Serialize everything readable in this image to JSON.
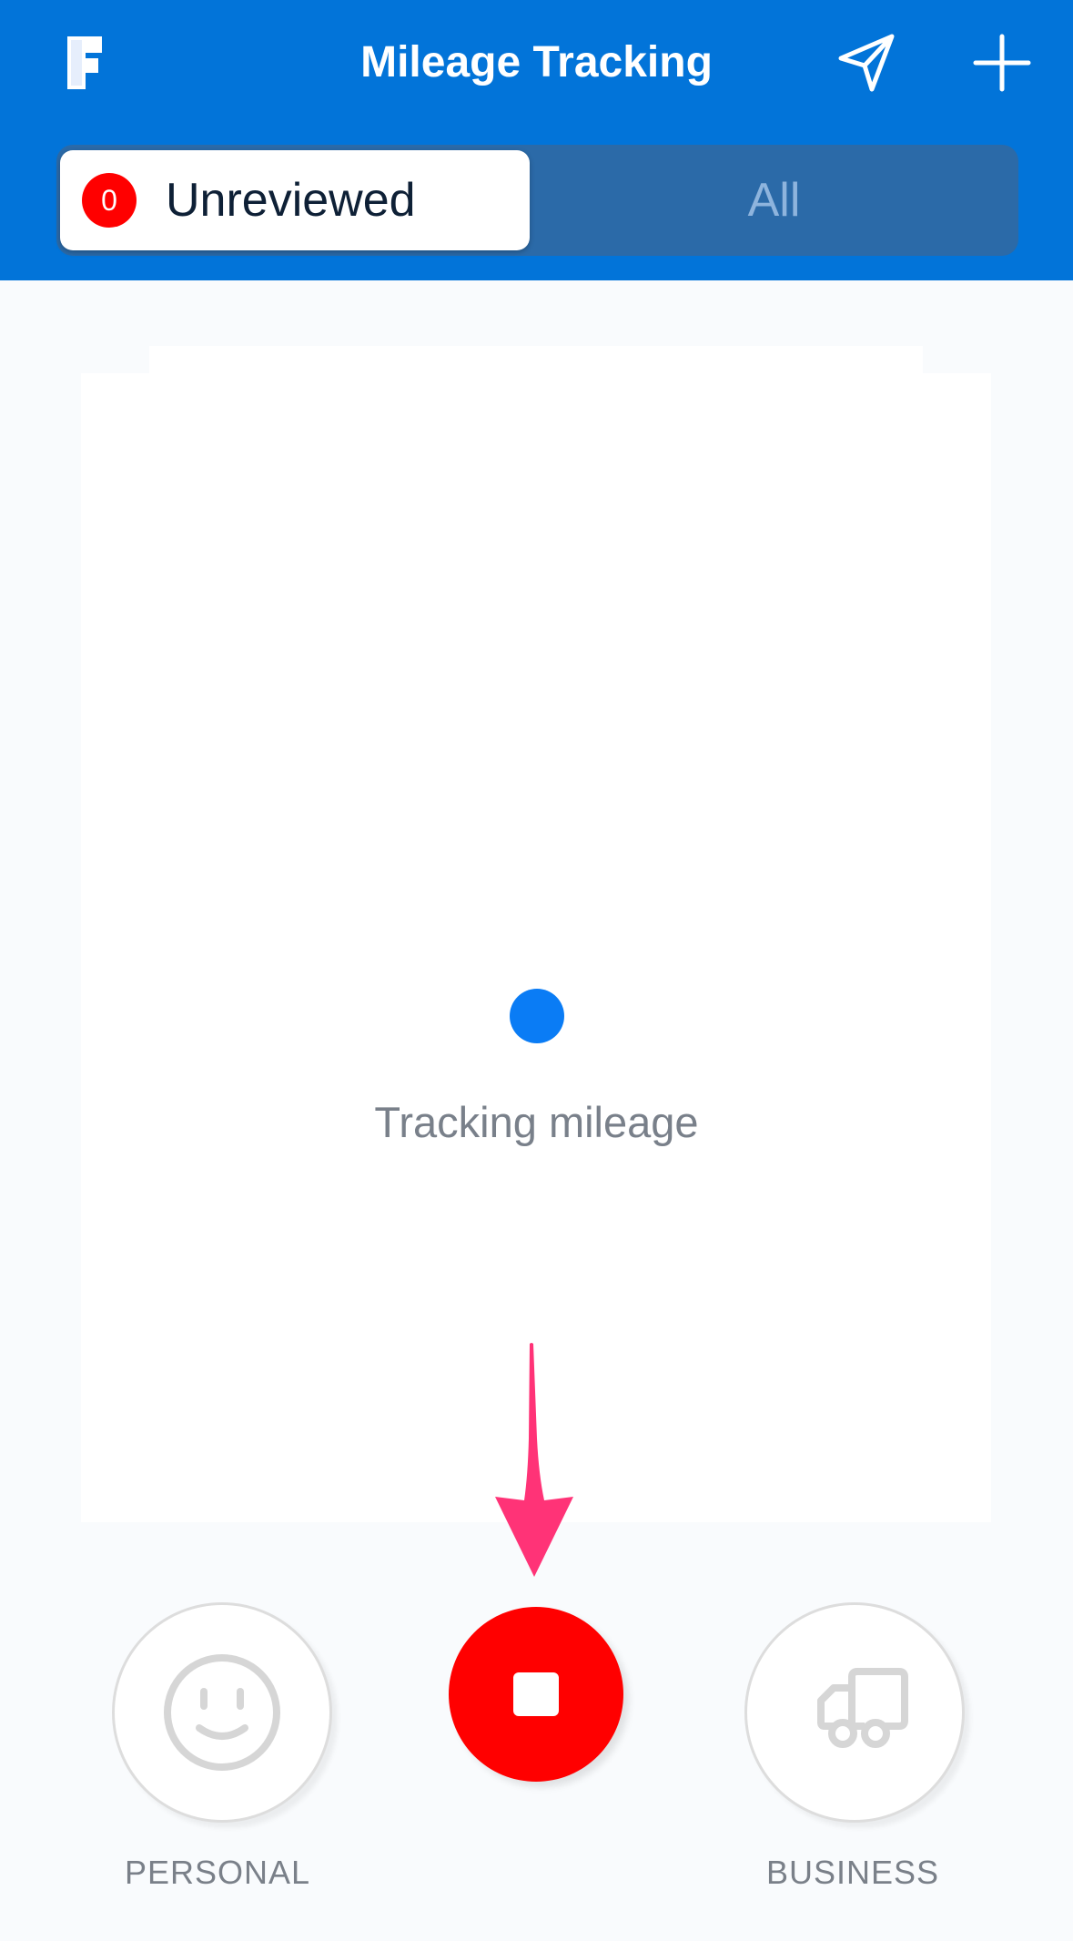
{
  "header": {
    "logo_icon": "f-logo-icon",
    "title": "Mileage Tracking",
    "send_icon": "paper-plane-icon",
    "add_icon": "plus-icon",
    "background_color": "#0274d9"
  },
  "segments": {
    "unreviewed": {
      "badge_count": "0",
      "label": "Unreviewed",
      "selected": true
    },
    "all": {
      "label": "All",
      "selected": false
    }
  },
  "status": {
    "indicator_color": "#0a7cf5",
    "text": "Tracking mileage"
  },
  "actions": {
    "personal": {
      "icon": "smiley-face-icon",
      "label": "PERSONAL"
    },
    "stop": {
      "icon": "stop-icon",
      "color": "#ff0000"
    },
    "business": {
      "icon": "truck-icon",
      "label": "BUSINESS"
    }
  },
  "annotation": {
    "arrow_icon": "pointer-arrow-icon",
    "color": "#ff3377"
  }
}
